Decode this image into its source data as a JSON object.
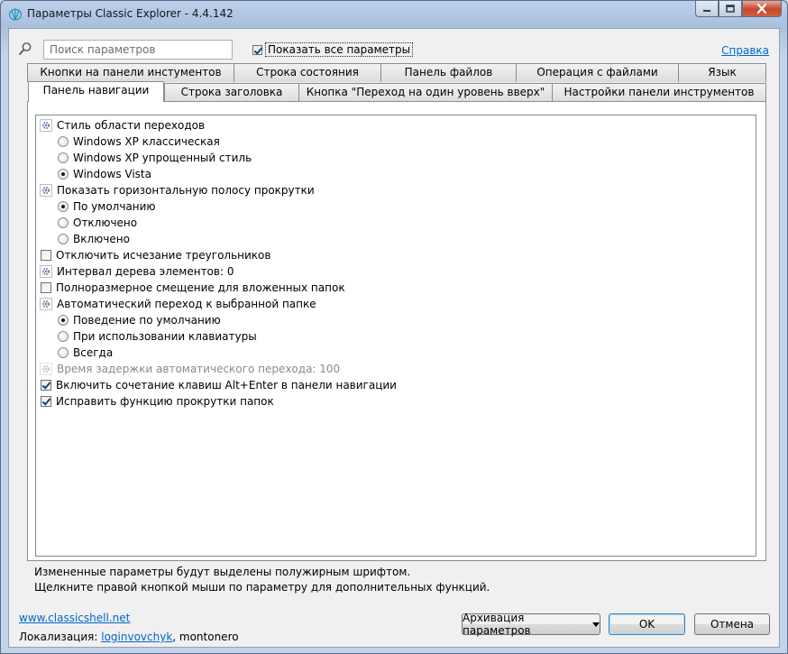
{
  "window": {
    "title": "Параметры Classic Explorer - 4.4.142"
  },
  "toolbar": {
    "search_placeholder": "Поиск параметров",
    "show_all_label": "Показать все параметры",
    "show_all_checked": true,
    "help_label": "Справка"
  },
  "tabs": {
    "row1": [
      "Кнопки на панели инстументов",
      "Строка состояния",
      "Панель файлов",
      "Операция с файлами",
      "Язык"
    ],
    "row2": [
      "Панель навигации",
      "Строка заголовка",
      "Кнопка \"Переход на один уровень вверх\"",
      "Настройки панели инструментов"
    ],
    "active": "Панель навигации"
  },
  "settings": [
    {
      "type": "group",
      "label": "Стиль области переходов"
    },
    {
      "type": "radio",
      "label": "Windows XP классическая",
      "checked": false
    },
    {
      "type": "radio",
      "label": "Windows XP упрощенный стиль",
      "checked": false
    },
    {
      "type": "radio",
      "label": "Windows Vista",
      "checked": true
    },
    {
      "type": "group",
      "label": "Показать горизонтальную полосу прокрутки"
    },
    {
      "type": "radio",
      "label": "По умолчанию",
      "checked": true
    },
    {
      "type": "radio",
      "label": "Отключено",
      "checked": false
    },
    {
      "type": "radio",
      "label": "Включено",
      "checked": false
    },
    {
      "type": "checkbox",
      "label": "Отключить исчезание треугольников",
      "checked": false
    },
    {
      "type": "group",
      "label": "Интервал дерева элементов: 0"
    },
    {
      "type": "checkbox",
      "label": "Полноразмерное смещение для вложенных папок",
      "checked": false
    },
    {
      "type": "group",
      "label": "Автоматический переход к выбранной папке"
    },
    {
      "type": "radio",
      "label": "Поведение по умолчанию",
      "checked": true
    },
    {
      "type": "radio",
      "label": "При использовании клавиатуры",
      "checked": false
    },
    {
      "type": "radio",
      "label": "Всегда",
      "checked": false
    },
    {
      "type": "group",
      "label": "Время задержки автоматического перехода: 100",
      "disabled": true
    },
    {
      "type": "checkbox",
      "label": "Включить сочетание клавиш Alt+Enter в панели навигации",
      "checked": true
    },
    {
      "type": "checkbox",
      "label": "Исправить функцию прокрутки папок",
      "checked": true
    }
  ],
  "hints": {
    "line1": "Измененные параметры будут выделены полужирным шрифтом.",
    "line2": "Щелкните правой кнопкой мыши по параметру для дополнительных функций."
  },
  "footer": {
    "site": "www.classicshell.net",
    "localization_label": "Локализация:",
    "localization_link": "loginvovchyk",
    "localization_rest": ", montonero",
    "backup_label": "Архивация параметров",
    "ok_label": "OK",
    "cancel_label": "Отмена"
  },
  "colors": {
    "link": "#0066cc",
    "close_button": "#c7462a",
    "title_bar": "#bcd0ea"
  }
}
